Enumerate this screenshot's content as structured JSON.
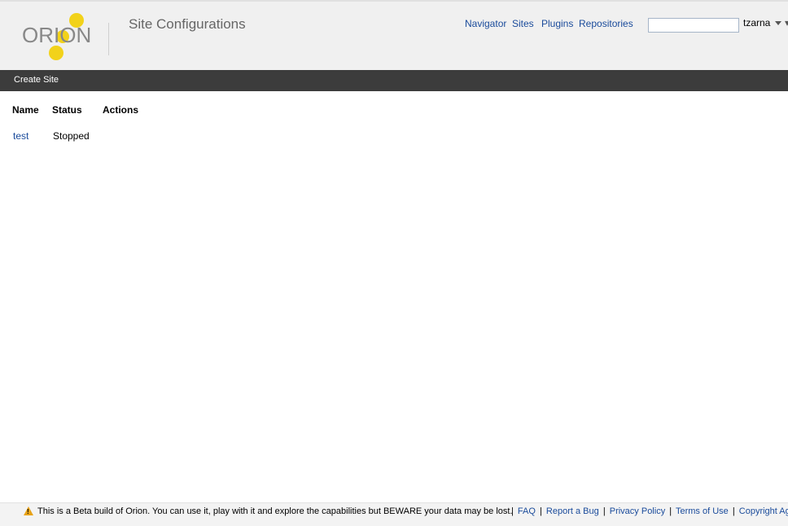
{
  "header": {
    "logo_text": "ORION",
    "page_title": "Site Configurations",
    "nav": [
      "Navigator",
      "Sites",
      "Plugins",
      "Repositories"
    ],
    "search": {
      "value": "",
      "placeholder": ""
    },
    "user": "tzarna"
  },
  "toolbar": {
    "create_site_label": "Create Site"
  },
  "table": {
    "columns": [
      "Name",
      "Status",
      "Actions"
    ],
    "rows": [
      {
        "name": "test",
        "status": "Stopped"
      }
    ]
  },
  "footer": {
    "message": "This is a Beta build of Orion. You can use it, play with it and explore the capabilities but BEWARE your data may be lost.",
    "links": [
      "FAQ",
      "Report a Bug",
      "Privacy Policy",
      "Terms of Use",
      "Copyright Agent"
    ]
  },
  "colors": {
    "accent": "#f2d21a",
    "link": "#1a4b9b",
    "toolbar": "#3c3c3c",
    "header_bg": "#f0f0f0"
  }
}
